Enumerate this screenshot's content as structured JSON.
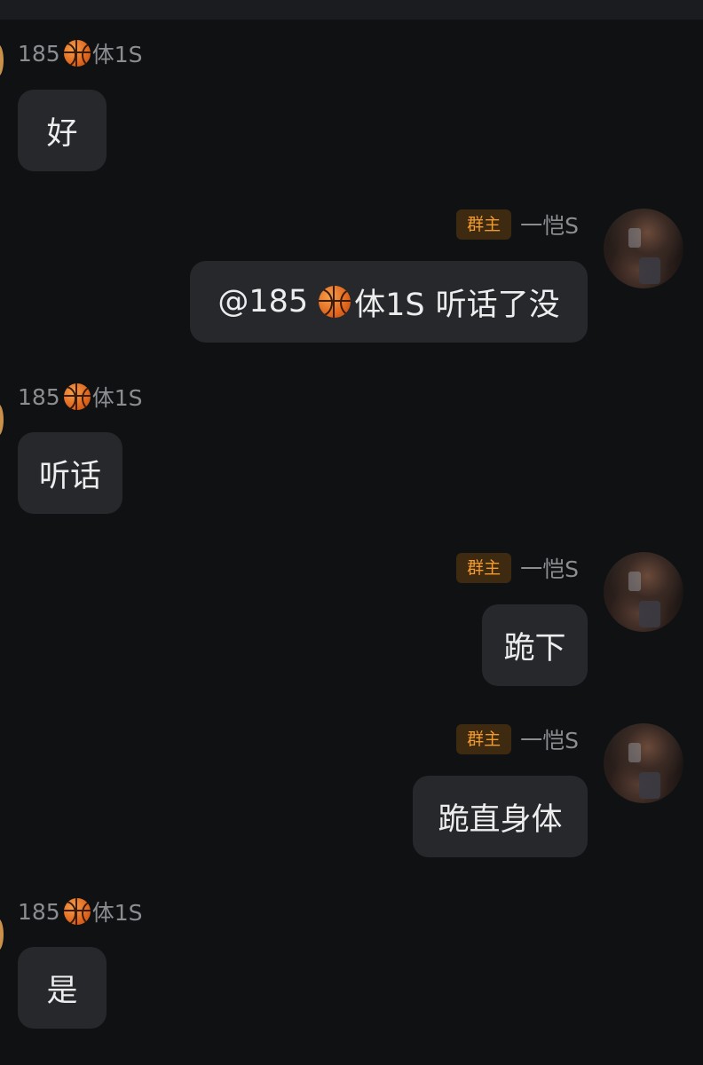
{
  "incoming_sender": {
    "name_prefix": "185",
    "emoji": "basketball-emoji",
    "name_suffix": "体1S"
  },
  "outgoing_sender": {
    "role_badge": "群主",
    "name": "一恺S"
  },
  "colors": {
    "background": "#0f1113",
    "bubble": "#26282c",
    "badge_text": "#f29a2e",
    "badge_bg": "#3d2a10",
    "nickname": "#8b8d91"
  },
  "messages": [
    {
      "side": "left",
      "text": "好"
    },
    {
      "side": "right",
      "mention_prefix": "@185",
      "mention_suffix": "体1S",
      "text": "听话了没"
    },
    {
      "side": "left",
      "text": "听话"
    },
    {
      "side": "right",
      "text": "跪下"
    },
    {
      "side": "right",
      "text": "跪直身体"
    },
    {
      "side": "left",
      "text": "是"
    }
  ]
}
